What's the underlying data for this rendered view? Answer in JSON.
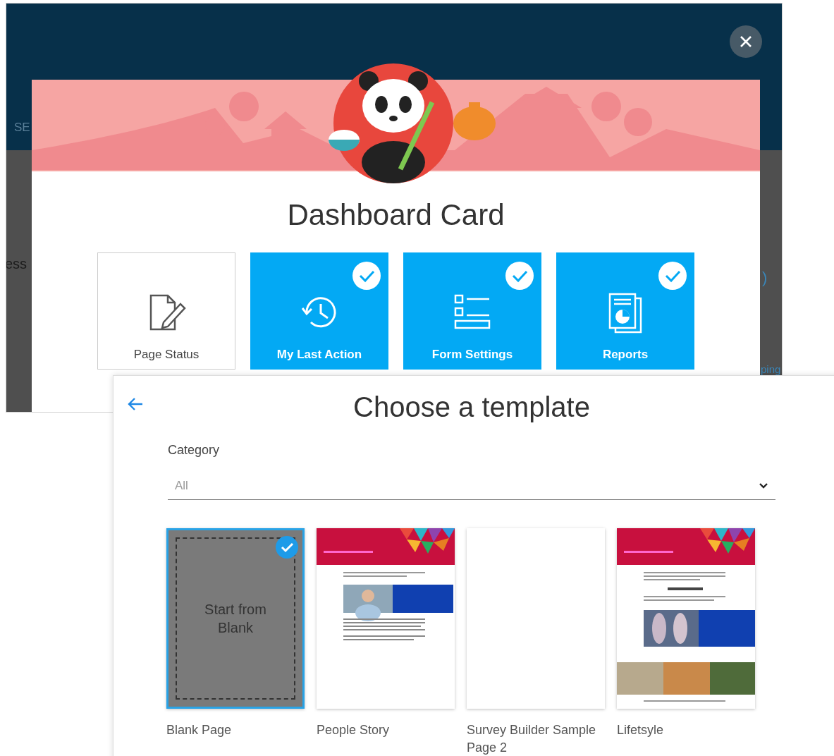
{
  "background_app": {
    "header_text": "SE",
    "side_texts": [
      "ess",
      ")",
      "ping"
    ]
  },
  "dashboard_dialog": {
    "title": "Dashboard Card",
    "cards": [
      {
        "label": "Page Status",
        "selected": false,
        "kind": "page"
      },
      {
        "label": "My Last Action",
        "selected": true,
        "kind": "history"
      },
      {
        "label": "Form Settings",
        "selected": true,
        "kind": "list"
      },
      {
        "label": "Reports",
        "selected": true,
        "kind": "report"
      }
    ]
  },
  "template_panel": {
    "title": "Choose a template",
    "category": {
      "label": "Category",
      "value": "All"
    },
    "templates": [
      {
        "name": "Blank Page",
        "selected": true,
        "kind": "blank",
        "caption": "Start from Blank"
      },
      {
        "name": "People Story",
        "selected": false,
        "kind": "article"
      },
      {
        "name": "Survey Builder Sample Page 2",
        "selected": false,
        "kind": "empty"
      },
      {
        "name": "Lifetsyle",
        "selected": false,
        "kind": "photo_article"
      }
    ]
  }
}
